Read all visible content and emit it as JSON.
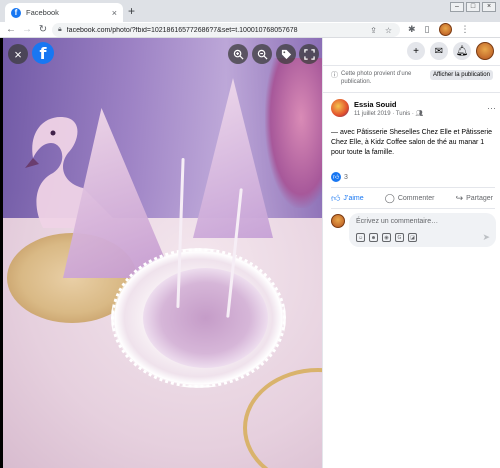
{
  "browser": {
    "tab_title": "Facebook",
    "tab_close": "×",
    "new_tab": "+",
    "url": "facebook.com/photo/?fbid=102186165772686?7&set=t.100010768057678",
    "window_buttons": [
      "–",
      "□",
      "×"
    ]
  },
  "photo_controls": {
    "close": "×",
    "fb_logo": "f"
  },
  "panel": {
    "info_text": "Cette photo provient d’une publication.",
    "show_post_button": "Afficher la publication",
    "author_name": "Essia Souid",
    "post_meta": "11 juillet 2019 · Tunis ·",
    "more_button": "···",
    "caption": "— avec Pâtisserie Sheselles Chez Elle et Pâtisserie Chez Elle, à Kidz Coffee salon de thé au manar 1 pour toute la famille.",
    "reaction_count": "3",
    "actions": {
      "like": "J’aime",
      "comment": "Commenter",
      "share": "Partager"
    },
    "comment_placeholder": "Écrivez un commentaire…"
  },
  "colors": {
    "facebook_blue": "#1877f2",
    "secondary_text": "#65676b"
  }
}
